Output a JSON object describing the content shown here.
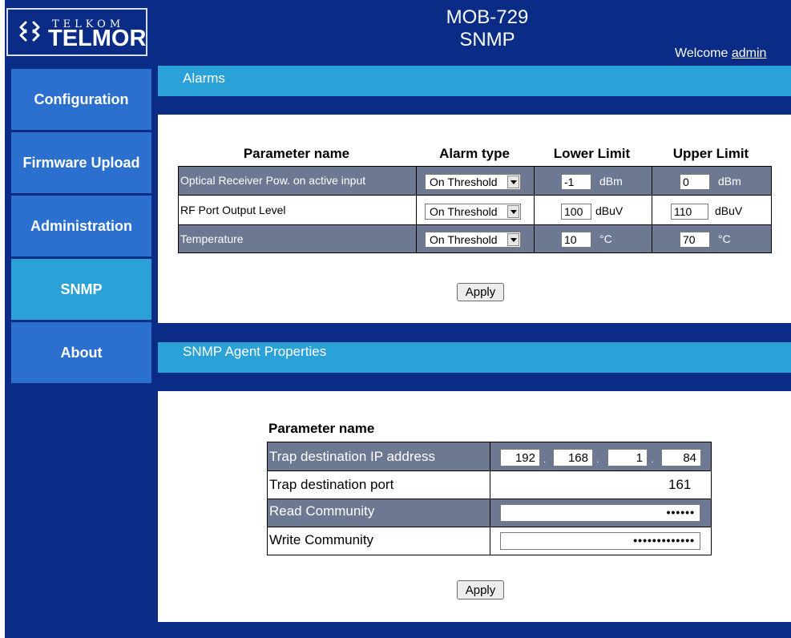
{
  "header": {
    "logo_small": "TELKOM",
    "logo_large": "TELMOR",
    "device": "MOB-729",
    "page": "SNMP",
    "welcome_prefix": "Welcome ",
    "user": "admin"
  },
  "sidebar": {
    "items": [
      {
        "label": "Configuration"
      },
      {
        "label": "Firmware Upload"
      },
      {
        "label": "Administration"
      },
      {
        "label": "SNMP",
        "active": true
      },
      {
        "label": "About"
      }
    ]
  },
  "alarms": {
    "title": "Alarms",
    "columns": [
      "Parameter name",
      "Alarm type",
      "Lower Limit",
      "Upper Limit"
    ],
    "rows": [
      {
        "name": "Optical Receiver Pow. on active input",
        "type": "On Threshold",
        "lower": "-1",
        "lower_unit": "dBm",
        "upper": "0",
        "upper_unit": "dBm"
      },
      {
        "name": "RF Port Output Level",
        "type": "On Threshold",
        "lower": "100",
        "lower_unit": "dBuV",
        "upper": "110",
        "upper_unit": "dBuV"
      },
      {
        "name": "Temperature",
        "type": "On Threshold",
        "lower": "10",
        "lower_unit": "°C",
        "upper": "70",
        "upper_unit": "°C"
      }
    ],
    "apply_label": "Apply"
  },
  "snmp": {
    "title": "SNMP Agent Properties",
    "column": "Parameter name",
    "trap_ip_label": "Trap destination IP address",
    "ip": [
      "192",
      "168",
      "1",
      "84"
    ],
    "ip_sep": ".",
    "trap_port_label": "Trap destination port",
    "trap_port": "161",
    "read_label": "Read Community",
    "read_value": "••••••",
    "write_label": "Write Community",
    "write_value": "•••••••••••••",
    "apply_label": "Apply"
  },
  "colors": {
    "navy": "#0a2b86",
    "nav_blue": "#2b6fcf",
    "accent": "#2aa1d7",
    "row_dark": "#6d7892"
  }
}
